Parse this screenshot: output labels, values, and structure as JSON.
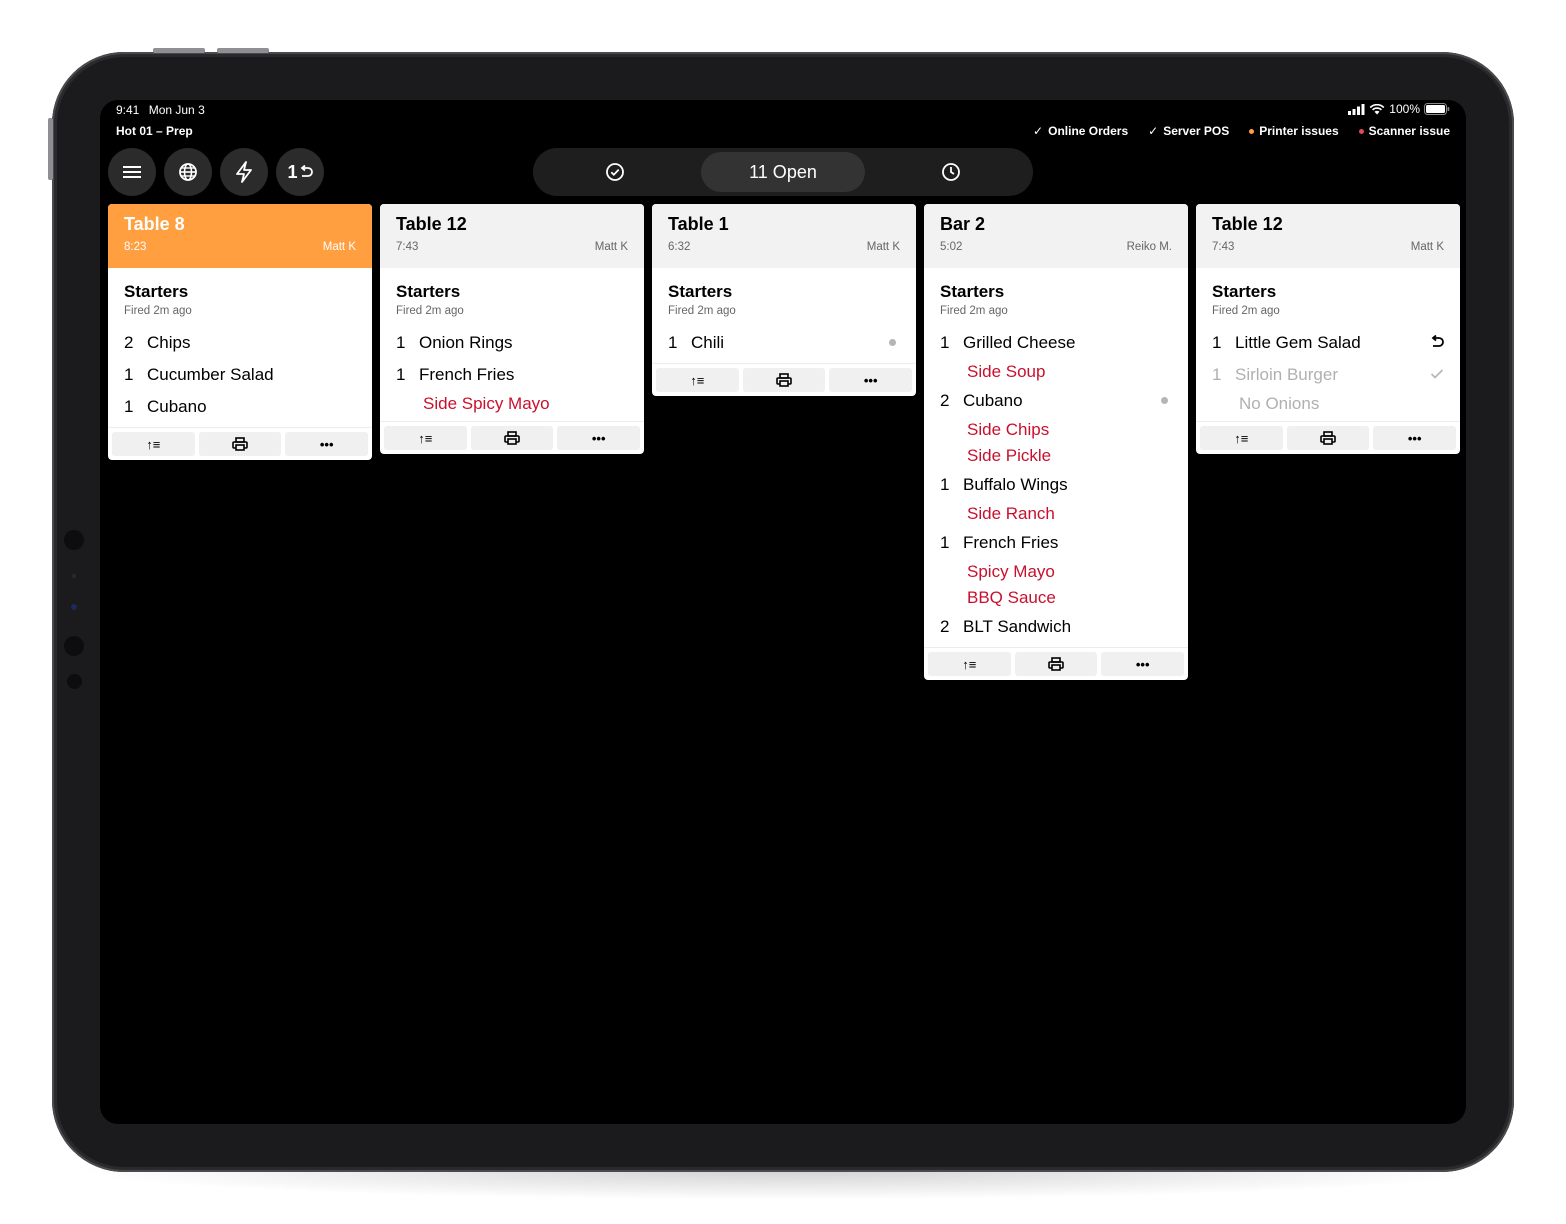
{
  "status_bar": {
    "time": "9:41",
    "date": "Mon Jun 3",
    "battery": "100%"
  },
  "station": "Hot 01 – Prep",
  "integrations": [
    {
      "label": "Online Orders",
      "state": "ok",
      "icon": "check-icon"
    },
    {
      "label": "Server POS",
      "state": "ok",
      "icon": "check-icon"
    },
    {
      "label": "Printer issues",
      "state": "warning",
      "color": "#ff9f40"
    },
    {
      "label": "Scanner issue",
      "state": "error",
      "color": "#e5484d"
    }
  ],
  "toolbar": {
    "menu_icon": "hamburger-menu-icon",
    "online_icon": "globe-icon",
    "quick_icon": "lightning-icon",
    "recall_label": "1"
  },
  "filter": {
    "completed_icon": "check-circle-icon",
    "open_label": "11 Open",
    "history_icon": "clock-icon"
  },
  "colors": {
    "urgent": "#ff9f40",
    "modifier": "#c8102e"
  },
  "tickets": [
    {
      "name": "Table 8",
      "time": "8:23",
      "server": "Matt K",
      "urgent": true,
      "course": "Starters",
      "fired": "Fired 2m ago",
      "items": [
        {
          "qty": "2",
          "name": "Chips",
          "mods": []
        },
        {
          "qty": "1",
          "name": "Cucumber Salad",
          "mods": []
        },
        {
          "qty": "1",
          "name": "Cubano",
          "mods": []
        }
      ]
    },
    {
      "name": "Table 12",
      "time": "7:43",
      "server": "Matt K",
      "course": "Starters",
      "fired": "Fired 2m ago",
      "items": [
        {
          "qty": "1",
          "name": "Onion Rings",
          "mods": []
        },
        {
          "qty": "1",
          "name": "French Fries",
          "mods": [
            "Side Spicy Mayo"
          ]
        }
      ]
    },
    {
      "name": "Table 1",
      "time": "6:32",
      "server": "Matt K",
      "course": "Starters",
      "fired": "Fired 2m ago",
      "items": [
        {
          "qty": "1",
          "name": "Chili",
          "mods": [],
          "dot": true
        }
      ]
    },
    {
      "name": "Bar 2",
      "time": "5:02",
      "server": "Reiko M.",
      "course": "Starters",
      "fired": "Fired 2m ago",
      "items": [
        {
          "qty": "1",
          "name": "Grilled Cheese",
          "mods": [
            "Side Soup"
          ]
        },
        {
          "qty": "2",
          "name": "Cubano",
          "mods": [
            "Side Chips",
            "Side Pickle"
          ],
          "dot": true
        },
        {
          "qty": "1",
          "name": "Buffalo Wings",
          "mods": [
            "Side Ranch"
          ]
        },
        {
          "qty": "1",
          "name": "French Fries",
          "mods": [
            "Spicy Mayo",
            "BBQ Sauce"
          ]
        },
        {
          "qty": "2",
          "name": "BLT Sandwich",
          "mods": []
        }
      ]
    },
    {
      "name": "Table 12",
      "time": "7:43",
      "server": "Matt K",
      "course": "Starters",
      "fired": "Fired 2m ago",
      "items": [
        {
          "qty": "1",
          "name": "Little Gem Salad",
          "mods": [],
          "flag": "undo-icon"
        },
        {
          "qty": "1",
          "name": "Sirloin Burger",
          "mods": [
            "No Onions"
          ],
          "done": true,
          "flag": "check-icon"
        }
      ]
    }
  ],
  "ticket_actions": [
    {
      "icon": "bump-list-icon",
      "glyph": "↑≡"
    },
    {
      "icon": "printer-icon",
      "glyph": "print"
    },
    {
      "icon": "more-icon",
      "glyph": "•••"
    }
  ]
}
